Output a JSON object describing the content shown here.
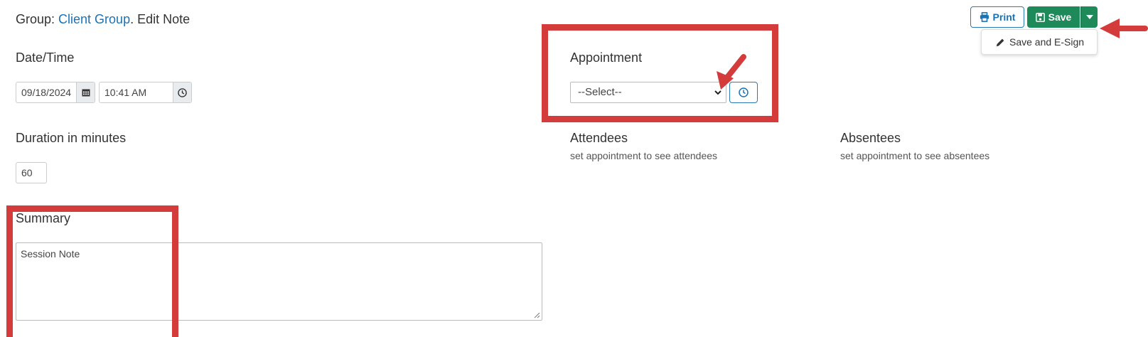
{
  "header": {
    "prefix": "Group: ",
    "group_link": "Client Group",
    "suffix": ". Edit Note"
  },
  "toolbar": {
    "print_label": "Print",
    "save_label": "Save",
    "dropdown_item": "Save and E-Sign"
  },
  "form": {
    "datetime_label": "Date/Time",
    "date_value": "09/18/2024",
    "time_value": "10:41 AM",
    "duration_label": "Duration in minutes",
    "duration_value": "60",
    "summary_label": "Summary",
    "summary_value": "Session Note",
    "appointment_label": "Appointment",
    "appointment_selected": "--Select--",
    "attendees_label": "Attendees",
    "attendees_note": "set appointment to see attendees",
    "absentees_label": "Absentees",
    "absentees_note": "set appointment to see absentees"
  },
  "colors": {
    "accent_blue": "#1a73b5",
    "save_green": "#1e8a5a",
    "annotation_red": "#d43b3b"
  }
}
